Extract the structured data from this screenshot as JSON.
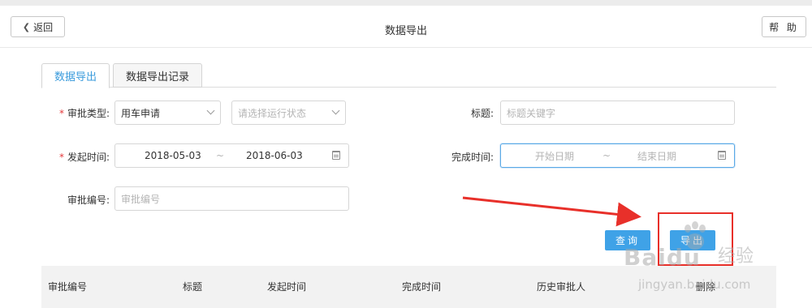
{
  "header": {
    "back_label": "返回",
    "title": "数据导出",
    "help_label": "帮 助"
  },
  "tabs": [
    {
      "label": "数据导出",
      "active": true
    },
    {
      "label": "数据导出记录",
      "active": false
    }
  ],
  "form": {
    "approval_type": {
      "label": "审批类型:",
      "value": "用车申请",
      "status_placeholder": "请选择运行状态"
    },
    "title": {
      "label": "标题:",
      "placeholder": "标题关键字"
    },
    "start_time": {
      "label": "发起时间:",
      "from": "2018-05-03",
      "separator": "~",
      "to": "2018-06-03"
    },
    "finish_time": {
      "label": "完成时间:",
      "from_placeholder": "开始日期",
      "separator": "~",
      "to_placeholder": "结束日期"
    },
    "approval_no": {
      "label": "审批编号:",
      "placeholder": "审批编号"
    }
  },
  "actions": {
    "query_label": "查询",
    "export_label": "导出"
  },
  "table": {
    "headers": [
      "审批编号",
      "标题",
      "发起时间",
      "完成时间",
      "历史审批人",
      "删除"
    ]
  },
  "watermark": {
    "brand": "Baidu",
    "cn": "经验",
    "url": "jingyan.baidu.com"
  },
  "colors": {
    "accent": "#3fa2e7",
    "required": "#e4393c",
    "annotation": "#e8302a"
  }
}
